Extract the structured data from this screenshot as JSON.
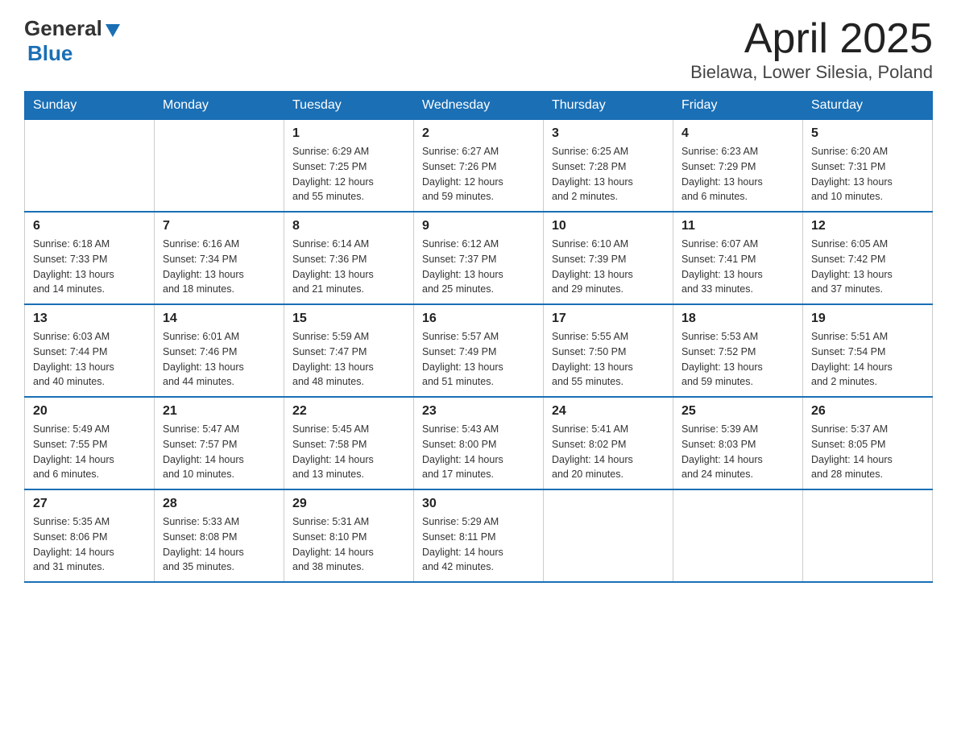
{
  "header": {
    "logo_general": "General",
    "logo_blue": "Blue",
    "title": "April 2025",
    "subtitle": "Bielawa, Lower Silesia, Poland"
  },
  "calendar": {
    "days_of_week": [
      "Sunday",
      "Monday",
      "Tuesday",
      "Wednesday",
      "Thursday",
      "Friday",
      "Saturday"
    ],
    "weeks": [
      [
        {
          "day": "",
          "info": ""
        },
        {
          "day": "",
          "info": ""
        },
        {
          "day": "1",
          "info": "Sunrise: 6:29 AM\nSunset: 7:25 PM\nDaylight: 12 hours\nand 55 minutes."
        },
        {
          "day": "2",
          "info": "Sunrise: 6:27 AM\nSunset: 7:26 PM\nDaylight: 12 hours\nand 59 minutes."
        },
        {
          "day": "3",
          "info": "Sunrise: 6:25 AM\nSunset: 7:28 PM\nDaylight: 13 hours\nand 2 minutes."
        },
        {
          "day": "4",
          "info": "Sunrise: 6:23 AM\nSunset: 7:29 PM\nDaylight: 13 hours\nand 6 minutes."
        },
        {
          "day": "5",
          "info": "Sunrise: 6:20 AM\nSunset: 7:31 PM\nDaylight: 13 hours\nand 10 minutes."
        }
      ],
      [
        {
          "day": "6",
          "info": "Sunrise: 6:18 AM\nSunset: 7:33 PM\nDaylight: 13 hours\nand 14 minutes."
        },
        {
          "day": "7",
          "info": "Sunrise: 6:16 AM\nSunset: 7:34 PM\nDaylight: 13 hours\nand 18 minutes."
        },
        {
          "day": "8",
          "info": "Sunrise: 6:14 AM\nSunset: 7:36 PM\nDaylight: 13 hours\nand 21 minutes."
        },
        {
          "day": "9",
          "info": "Sunrise: 6:12 AM\nSunset: 7:37 PM\nDaylight: 13 hours\nand 25 minutes."
        },
        {
          "day": "10",
          "info": "Sunrise: 6:10 AM\nSunset: 7:39 PM\nDaylight: 13 hours\nand 29 minutes."
        },
        {
          "day": "11",
          "info": "Sunrise: 6:07 AM\nSunset: 7:41 PM\nDaylight: 13 hours\nand 33 minutes."
        },
        {
          "day": "12",
          "info": "Sunrise: 6:05 AM\nSunset: 7:42 PM\nDaylight: 13 hours\nand 37 minutes."
        }
      ],
      [
        {
          "day": "13",
          "info": "Sunrise: 6:03 AM\nSunset: 7:44 PM\nDaylight: 13 hours\nand 40 minutes."
        },
        {
          "day": "14",
          "info": "Sunrise: 6:01 AM\nSunset: 7:46 PM\nDaylight: 13 hours\nand 44 minutes."
        },
        {
          "day": "15",
          "info": "Sunrise: 5:59 AM\nSunset: 7:47 PM\nDaylight: 13 hours\nand 48 minutes."
        },
        {
          "day": "16",
          "info": "Sunrise: 5:57 AM\nSunset: 7:49 PM\nDaylight: 13 hours\nand 51 minutes."
        },
        {
          "day": "17",
          "info": "Sunrise: 5:55 AM\nSunset: 7:50 PM\nDaylight: 13 hours\nand 55 minutes."
        },
        {
          "day": "18",
          "info": "Sunrise: 5:53 AM\nSunset: 7:52 PM\nDaylight: 13 hours\nand 59 minutes."
        },
        {
          "day": "19",
          "info": "Sunrise: 5:51 AM\nSunset: 7:54 PM\nDaylight: 14 hours\nand 2 minutes."
        }
      ],
      [
        {
          "day": "20",
          "info": "Sunrise: 5:49 AM\nSunset: 7:55 PM\nDaylight: 14 hours\nand 6 minutes."
        },
        {
          "day": "21",
          "info": "Sunrise: 5:47 AM\nSunset: 7:57 PM\nDaylight: 14 hours\nand 10 minutes."
        },
        {
          "day": "22",
          "info": "Sunrise: 5:45 AM\nSunset: 7:58 PM\nDaylight: 14 hours\nand 13 minutes."
        },
        {
          "day": "23",
          "info": "Sunrise: 5:43 AM\nSunset: 8:00 PM\nDaylight: 14 hours\nand 17 minutes."
        },
        {
          "day": "24",
          "info": "Sunrise: 5:41 AM\nSunset: 8:02 PM\nDaylight: 14 hours\nand 20 minutes."
        },
        {
          "day": "25",
          "info": "Sunrise: 5:39 AM\nSunset: 8:03 PM\nDaylight: 14 hours\nand 24 minutes."
        },
        {
          "day": "26",
          "info": "Sunrise: 5:37 AM\nSunset: 8:05 PM\nDaylight: 14 hours\nand 28 minutes."
        }
      ],
      [
        {
          "day": "27",
          "info": "Sunrise: 5:35 AM\nSunset: 8:06 PM\nDaylight: 14 hours\nand 31 minutes."
        },
        {
          "day": "28",
          "info": "Sunrise: 5:33 AM\nSunset: 8:08 PM\nDaylight: 14 hours\nand 35 minutes."
        },
        {
          "day": "29",
          "info": "Sunrise: 5:31 AM\nSunset: 8:10 PM\nDaylight: 14 hours\nand 38 minutes."
        },
        {
          "day": "30",
          "info": "Sunrise: 5:29 AM\nSunset: 8:11 PM\nDaylight: 14 hours\nand 42 minutes."
        },
        {
          "day": "",
          "info": ""
        },
        {
          "day": "",
          "info": ""
        },
        {
          "day": "",
          "info": ""
        }
      ]
    ]
  }
}
